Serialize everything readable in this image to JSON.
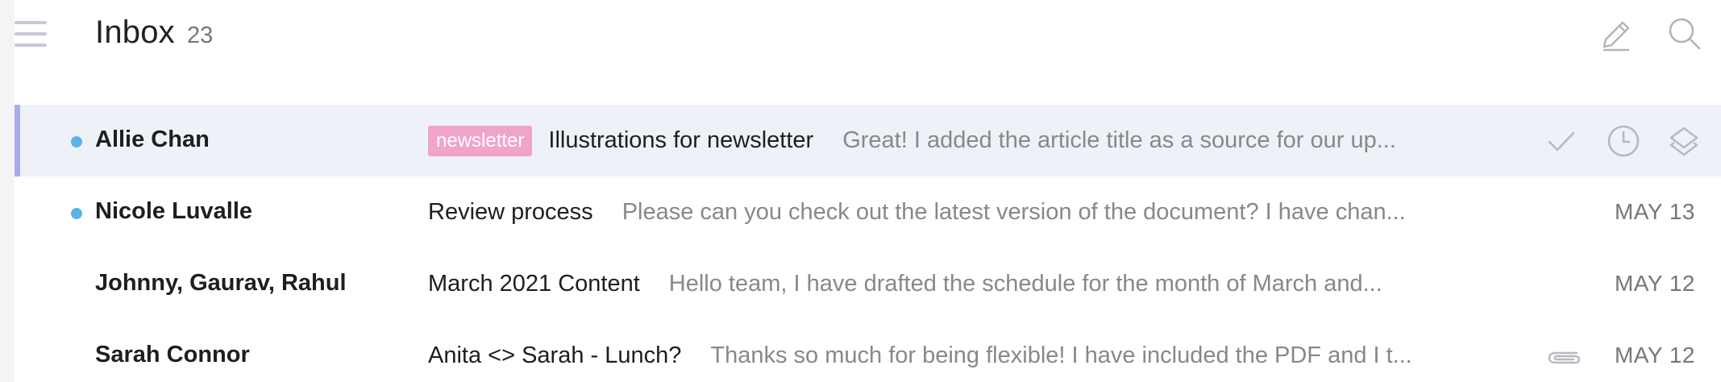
{
  "header": {
    "title": "Inbox",
    "count": "23"
  },
  "colors": {
    "accent_bar": "#a9abe6",
    "unread_dot": "#5cb3e6",
    "newsletter_tag": "#f0a4c8",
    "selected_row_bg": "#eef2f8"
  },
  "icons": [
    "hamburger-menu-icon",
    "compose-pencil-icon",
    "search-icon",
    "checkmark-icon",
    "clock-icon",
    "layers-icon",
    "paperclip-icon"
  ],
  "emails": [
    {
      "sender": "Allie Chan",
      "unread": true,
      "selected": true,
      "tag": "newsletter",
      "subject": "Illustrations for newsletter",
      "snippet": "Great! I added the article title as a source for our up...",
      "date": ""
    },
    {
      "sender": "Nicole Luvalle",
      "unread": true,
      "selected": false,
      "tag": "",
      "subject": "Review process",
      "snippet": "Please can you check out the latest version of the document? I have chan...",
      "date": "MAY 13"
    },
    {
      "sender": "Johnny, Gaurav, Rahul",
      "unread": false,
      "selected": false,
      "tag": "",
      "subject": "March 2021 Content",
      "snippet": "Hello team, I have drafted the schedule for the month of March and...",
      "date": "MAY 12"
    },
    {
      "sender": "Sarah Connor",
      "unread": false,
      "selected": false,
      "tag": "",
      "subject": "Anita <> Sarah - Lunch?",
      "snippet": "Thanks so much for being flexible! I have included the PDF and I t...",
      "date": "MAY 12",
      "attachment": true
    }
  ]
}
